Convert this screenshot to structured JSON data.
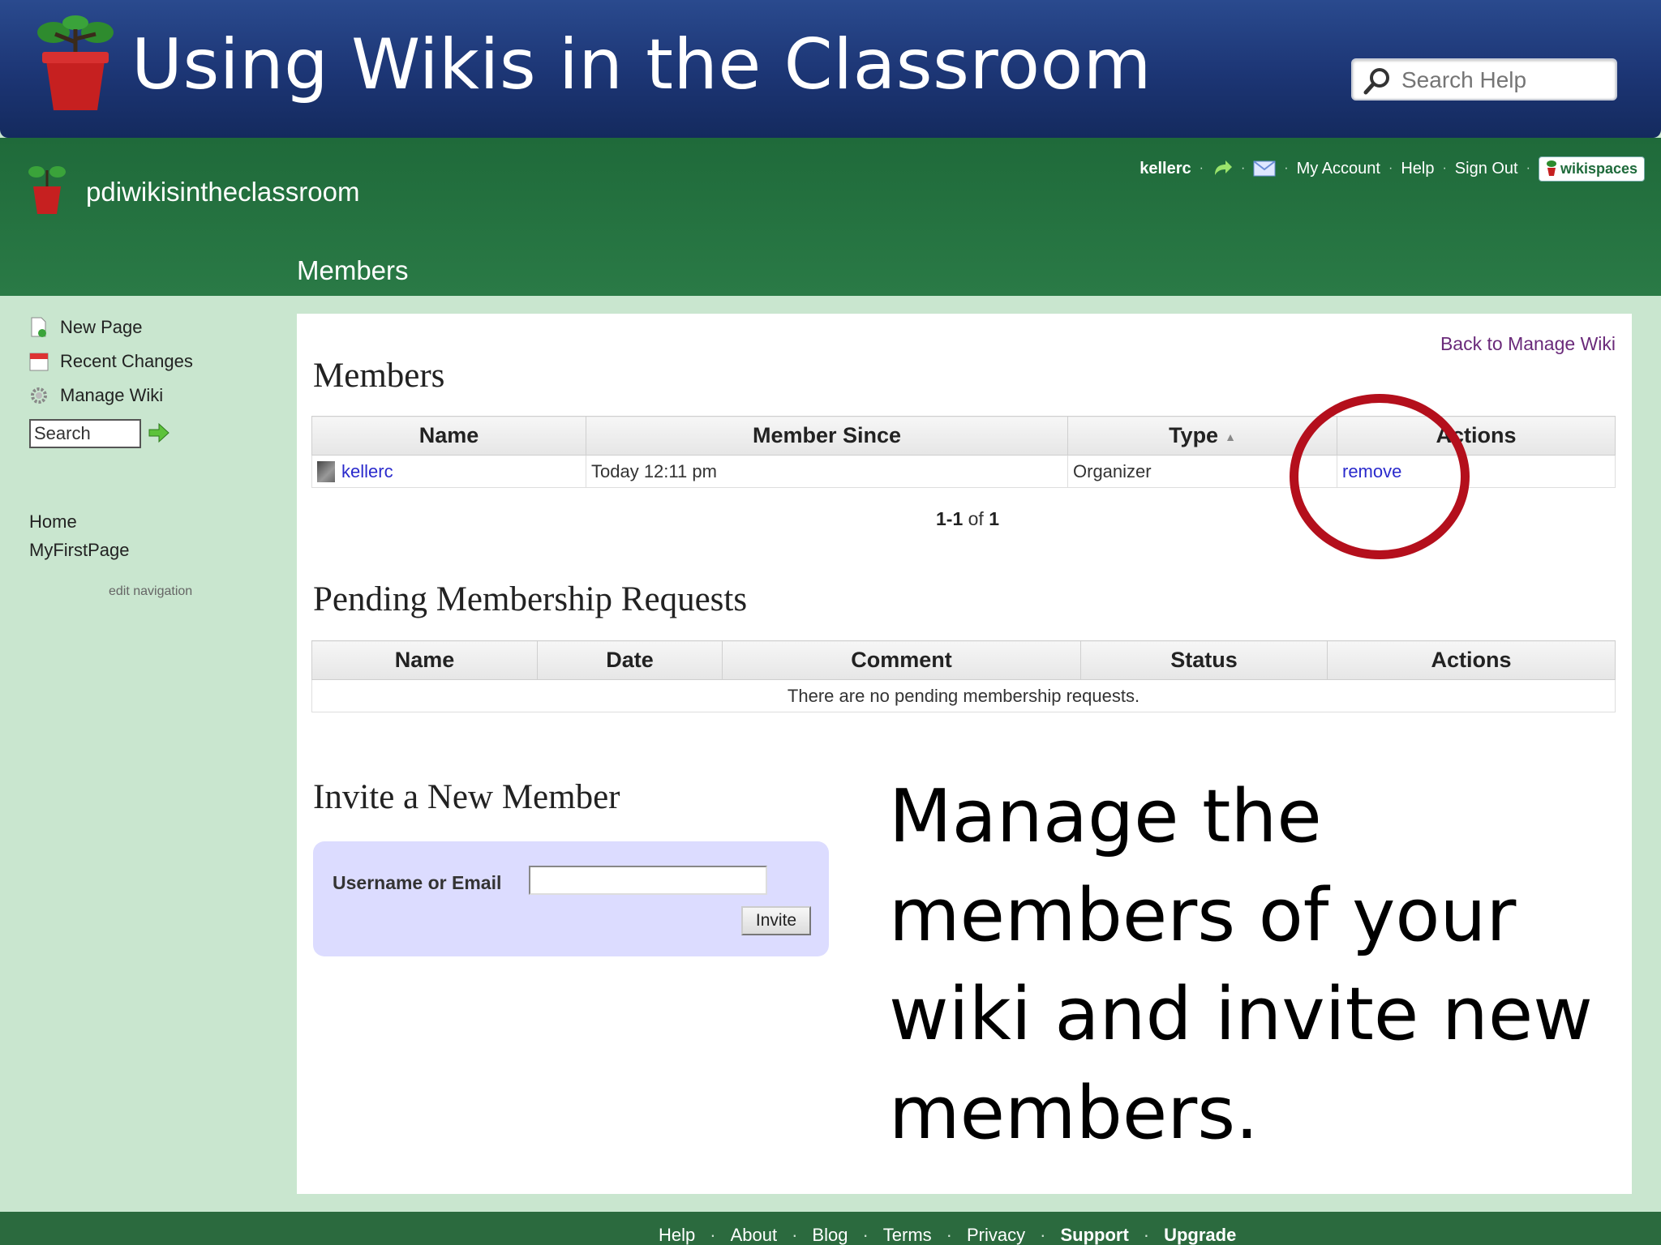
{
  "slide": {
    "title": "Using Wikis in the Classroom",
    "help_search_placeholder": "Search Help",
    "caption": "Manage the members of your wiki and invite new members."
  },
  "wiki": {
    "name": "pdiwikisintheclassroom",
    "page_heading": "Members",
    "user_bar": {
      "username": "kellerc",
      "my_account": "My Account",
      "help": "Help",
      "sign_out": "Sign Out",
      "badge": "wikispaces"
    }
  },
  "sidebar": {
    "tools": [
      {
        "label": "New Page",
        "icon": "new-page-icon"
      },
      {
        "label": "Recent Changes",
        "icon": "calendar-icon"
      },
      {
        "label": "Manage Wiki",
        "icon": "gear-icon"
      }
    ],
    "search_value": "Search",
    "links": [
      "Home",
      "MyFirstPage"
    ],
    "edit_navigation": "edit navigation"
  },
  "content": {
    "back_link": "Back to Manage Wiki",
    "members": {
      "title": "Members",
      "columns": [
        "Name",
        "Member Since",
        "Type",
        "Actions"
      ],
      "rows": [
        {
          "name": "kellerc",
          "member_since": "Today 12:11 pm",
          "type": "Organizer",
          "action": "remove"
        }
      ],
      "pager_range": "1-1",
      "pager_of": "of",
      "pager_total": "1"
    },
    "pending": {
      "title": "Pending Membership Requests",
      "columns": [
        "Name",
        "Date",
        "Comment",
        "Status",
        "Actions"
      ],
      "empty_message": "There are no pending membership requests."
    },
    "invite": {
      "title": "Invite a New Member",
      "label": "Username or Email",
      "input_value": "",
      "button": "Invite"
    }
  },
  "footer": {
    "links": [
      "Help",
      "About",
      "Blog",
      "Terms",
      "Privacy",
      "Support",
      "Upgrade"
    ]
  },
  "colors": {
    "banner": "#1c3574",
    "wiki_header": "#2a7a46",
    "sidebar_bg": "#c9e6cf",
    "highlight_circle": "#b40f1c",
    "invite_box": "#dcdcff"
  }
}
